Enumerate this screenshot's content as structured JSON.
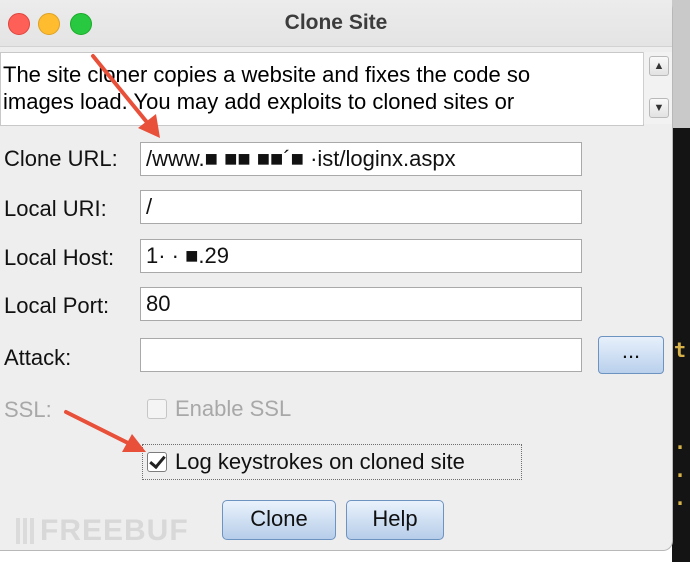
{
  "window": {
    "title": "Clone Site"
  },
  "description": {
    "text": "The site cloner copies a website and fixes the code so\nimages load. You may add exploits to cloned sites or"
  },
  "form": {
    "clone_url": {
      "label": "Clone URL:",
      "value": "/www.■ ■■ ■■´■ ·ist/loginx.aspx"
    },
    "local_uri": {
      "label": "Local URI:",
      "value": "/"
    },
    "local_host": {
      "label": "Local Host:",
      "value": "1· · ■.29"
    },
    "local_port": {
      "label": "Local Port:",
      "value": "80"
    },
    "attack": {
      "label": "Attack:",
      "value": "",
      "browse_label": "..."
    },
    "ssl": {
      "label": "SSL:",
      "checkbox_label": "Enable SSL",
      "checked": false,
      "enabled": false
    },
    "log_keystrokes": {
      "label": "Log keystrokes on cloned site",
      "checked": true
    }
  },
  "buttons": {
    "clone": "Clone",
    "help": "Help"
  },
  "scrollbar": {
    "up_icon": "▲",
    "down_icon": "▼"
  },
  "background_terminal": {
    "glyphs": [
      "t",
      ".",
      ".",
      "."
    ]
  },
  "watermark": {
    "text": "FREEBUF"
  },
  "colors": {
    "annotation_arrow": "#e8503a",
    "button_gradient_top": "#eaf2fc",
    "button_gradient_bottom": "#b6cde9"
  }
}
